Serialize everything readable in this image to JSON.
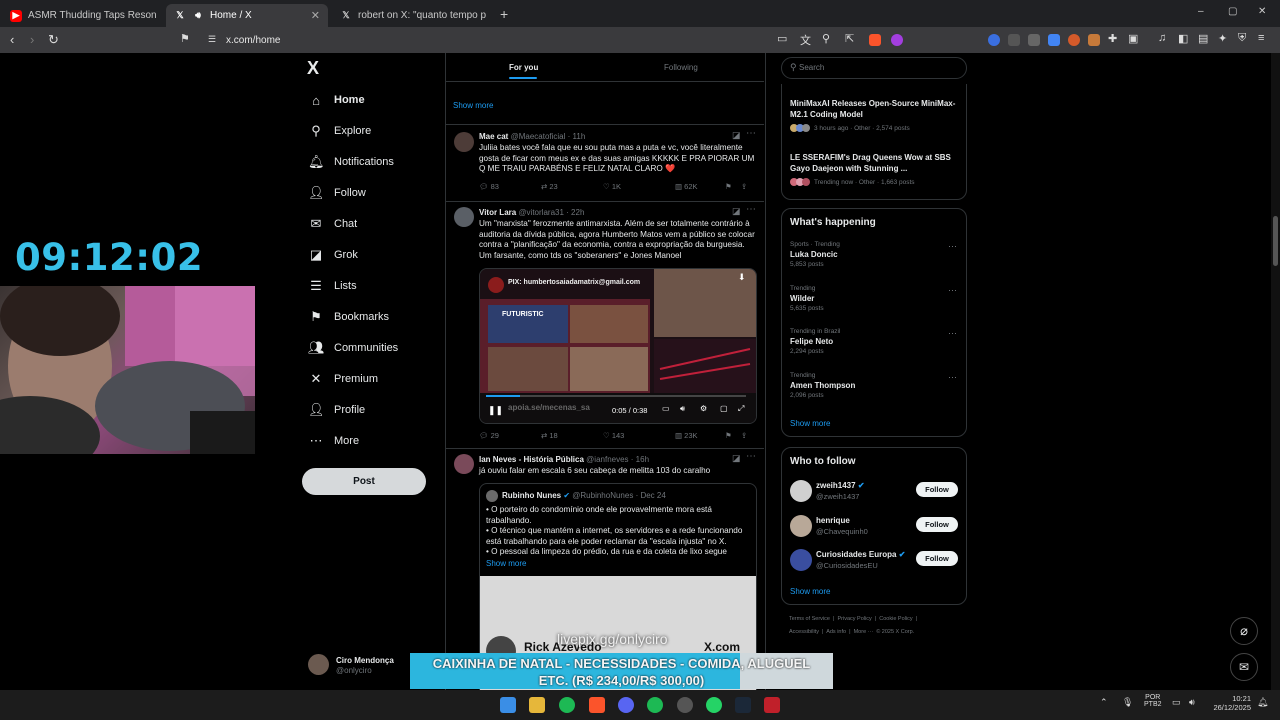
{
  "browser": {
    "tabs": [
      {
        "title": "ASMR Thudding Taps Resonating in '"
      },
      {
        "title": "Home / X"
      },
      {
        "title": "robert on X: \"quanto tempo pros bol"
      }
    ],
    "new_tab": "+",
    "url": "x.com/home",
    "window_controls": [
      "–",
      "▢",
      "✕"
    ]
  },
  "overlay": {
    "clock": "09:12:02",
    "livepix": "livepix.gg/onlyciro",
    "donation_line1": "CAIXINHA DE NATAL - NECESSIDADES - COMIDA, ALUGUEL",
    "donation_line2": "ETC. (R$ 234,00/R$ 300,00)",
    "donation_progress": 0.78
  },
  "sidebar": {
    "logo": "X",
    "items": [
      {
        "label": "Home",
        "icon": "home-icon",
        "glyph": "⌂"
      },
      {
        "label": "Explore",
        "icon": "search-icon",
        "glyph": "⚲"
      },
      {
        "label": "Notifications",
        "icon": "bell-icon",
        "glyph": "🔔︎"
      },
      {
        "label": "Follow",
        "icon": "person-add-icon",
        "glyph": "👤︎"
      },
      {
        "label": "Chat",
        "icon": "mail-icon",
        "glyph": "✉"
      },
      {
        "label": "Grok",
        "icon": "grok-icon",
        "glyph": "◪"
      },
      {
        "label": "Lists",
        "icon": "list-icon",
        "glyph": "☰"
      },
      {
        "label": "Bookmarks",
        "icon": "bookmark-icon",
        "glyph": "⚑"
      },
      {
        "label": "Communities",
        "icon": "communities-icon",
        "glyph": "👥︎"
      },
      {
        "label": "Premium",
        "icon": "x-premium-icon",
        "glyph": "✕"
      },
      {
        "label": "Profile",
        "icon": "person-icon",
        "glyph": "👤︎"
      },
      {
        "label": "More",
        "icon": "more-icon",
        "glyph": "⋯"
      }
    ],
    "post_label": "Post",
    "account": {
      "name": "Ciro Mendonça",
      "handle": "@onlyciro"
    }
  },
  "timeline": {
    "tabs": {
      "for_you": "For you",
      "following": "Following"
    },
    "show_more": "Show more",
    "tweets": [
      {
        "name": "Mae cat",
        "handle": "@Maecatoficial",
        "time": "· 11h",
        "text": "Juliia bates você fala que eu sou puta mas a puta e vc, você literalmente gosta de ficar com meus ex e das suas amigas KKKKK E PRA PIORAR UM Q ME TRAIU PARABÉNS E FELIZ NATAL CLARO ❤️",
        "replies": "83",
        "reposts": "23",
        "likes": "1K",
        "views": "62K"
      },
      {
        "name": "Vitor Lara",
        "handle": "@vitorlara31",
        "time": "· 22h",
        "text": "Um \"marxista\" ferozmente antimarxista. Além de ser totalmente contrário à auditoria da dívida pública, agora Humberto Matos vem a público se colocar contra a \"planificação\" da economia, contra a expropriação da burguesia. Um farsante, como tds os \"soberaners\" e Jones Manoel",
        "video": {
          "pix": "PIX: humbertosaiadamatrix@gmail.com",
          "banner": "FUTURISTIC",
          "footer": "apoia.se/mecenas_sa",
          "time": "0:05 / 0:38"
        },
        "replies": "29",
        "reposts": "18",
        "likes": "143",
        "views": "23K"
      },
      {
        "name": "Ian Neves - História Pública",
        "handle": "@ianfneves",
        "time": "· 16h",
        "text": "já ouviu falar em escala 6 seu cabeça de melitta 103 do caralho",
        "quote": {
          "name": "Rubinho Nunes",
          "handle": "@RubinhoNunes",
          "time": "· Dec 24",
          "lines": [
            "• O porteiro do condomínio onde ele provavelmente mora está trabalhando.",
            "• O técnico que mantém a internet, os servidores e a rede funcionando está trabalhando para ele poder reclamar da \"escala injusta\" no X.",
            "• O pessoal da limpeza do prédio, da rua e da coleta de lixo segue"
          ],
          "show_more": "Show more",
          "image_caption": "Rick Azevedo",
          "image_site": "X.com"
        }
      }
    ]
  },
  "right": {
    "search_placeholder": "Search",
    "news": [
      {
        "title": "MiniMaxAI Releases Open-Source MiniMax-M2.1 Coding Model",
        "meta": "3 hours ago · Other · 2,574 posts"
      },
      {
        "title": "LE SSERAFIM's Drag Queens Wow at SBS Gayo Daejeon with Stunning ...",
        "meta": "Trending now · Other · 1,663 posts"
      }
    ],
    "happening_title": "What's happening",
    "trends": [
      {
        "context": "Sports · Trending",
        "name": "Luka Doncic",
        "posts": "5,853 posts"
      },
      {
        "context": "Trending",
        "name": "Wilder",
        "posts": "5,635 posts"
      },
      {
        "context": "Trending in Brazil",
        "name": "Felipe Neto",
        "posts": "2,294 posts"
      },
      {
        "context": "Trending",
        "name": "Amen Thompson",
        "posts": "2,096 posts"
      }
    ],
    "show_more": "Show more",
    "who_title": "Who to follow",
    "who": [
      {
        "name": "zweih1437",
        "handle": "@zweih1437",
        "verified": true
      },
      {
        "name": "henrique",
        "handle": "@Chavequinh0",
        "verified": false
      },
      {
        "name": "Curiosidades Europa",
        "handle": "@CuriosidadesEU",
        "verified": true
      }
    ],
    "follow_label": "Follow",
    "footer_line1": "Terms of Service  |  Privacy Policy  |  Cookie Policy  |",
    "footer_line2": "Accessibility  |  Ads info  |  More ···  © 2025 X Corp."
  },
  "taskbar": {
    "lang1": "POR",
    "lang2": "PTB2",
    "time": "10:21",
    "date": "26/12/2025"
  },
  "colors": {
    "accent": "#1d9bf0",
    "clock": "#38c0e8",
    "donation_bg": "#2cb6de"
  }
}
